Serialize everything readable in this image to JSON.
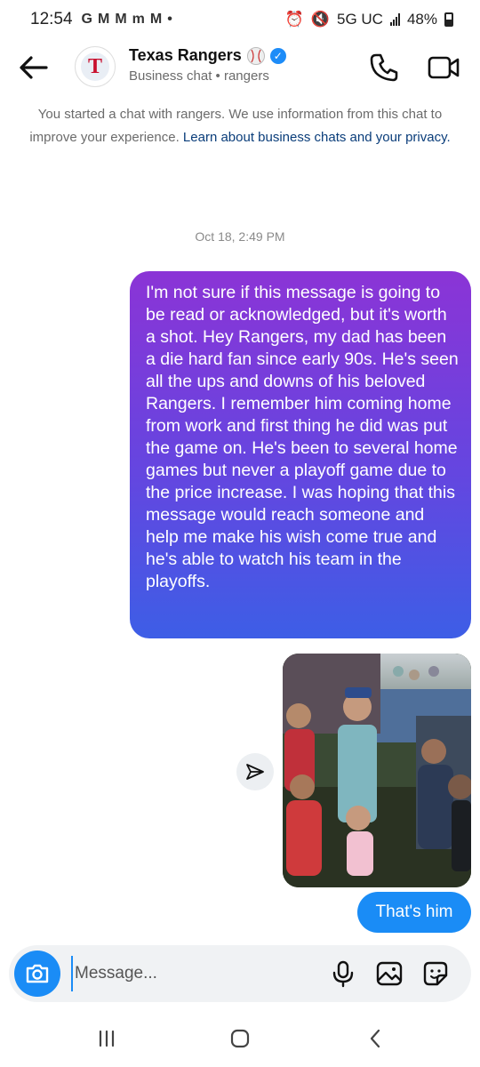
{
  "status_bar": {
    "time": "12:54",
    "notifications": [
      "G",
      "M",
      "M",
      "m",
      "M",
      "•"
    ],
    "network": "5G UC",
    "battery": "48%"
  },
  "header": {
    "title": "Texas Rangers",
    "subtitle": "Business chat • rangers",
    "avatar_letter": "T"
  },
  "notice": {
    "text": "You started a chat with rangers. We use information from this chat to improve your experience. ",
    "link": "Learn about business chats and your privacy."
  },
  "thread": {
    "timestamp": "Oct 18, 2:49 PM",
    "message": "I'm not sure if this message is going to be read or acknowledged, but it's worth a shot. Hey Rangers, my dad has been a die hard fan since early 90s. He's seen all the ups and downs of his beloved Rangers. I remember him coming home from work and first thing he did was put the game on. He's been to several home games but never a playoff game due to the price increase.   I was hoping that this message would reach someone and help me make his wish come true and he's able to watch his team in the playoffs.",
    "reply": "That's him"
  },
  "composer": {
    "placeholder": "Message..."
  },
  "colors": {
    "accent": "#1a8cf6",
    "bubble_top": "#8b34d6",
    "bubble_bottom": "#3d5ee6"
  },
  "icons": {
    "back": "arrow-left-icon",
    "call": "phone-icon",
    "video": "video-camera-icon",
    "share": "paper-plane-icon",
    "camera": "camera-icon",
    "mic": "microphone-icon",
    "gallery": "image-icon",
    "sticker": "sticker-icon"
  }
}
